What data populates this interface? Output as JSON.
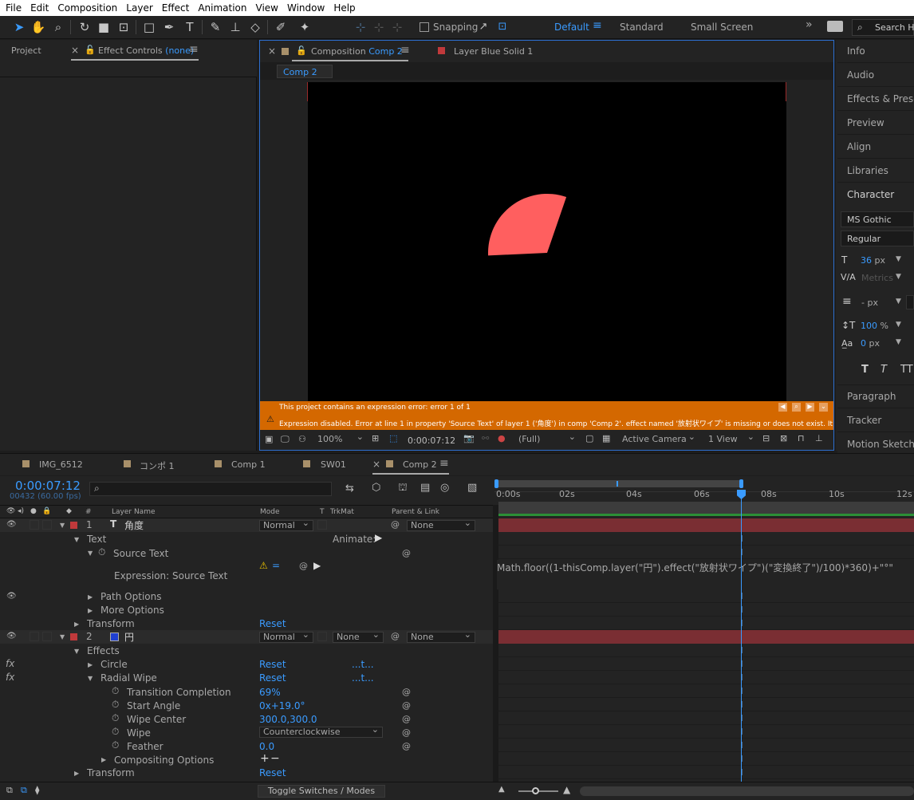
{
  "menu": [
    "File",
    "Edit",
    "Composition",
    "Layer",
    "Effect",
    "Animation",
    "View",
    "Window",
    "Help"
  ],
  "toolbar": {
    "snapping": "Snapping",
    "workspaces": [
      "Default",
      "Standard",
      "Small Screen"
    ],
    "search": "Search Help"
  },
  "left_panel": {
    "project_tab": "Project",
    "effect_controls_label": "Effect Controls",
    "effect_controls_value": "(none)"
  },
  "comp_panel": {
    "comp_tab_prefix": "Composition",
    "comp_tab_name": "Comp 2",
    "layer_tab": "Layer  Blue Solid 1",
    "subtab": "Comp 2",
    "error_title": "This project contains an expression error: error 1 of 1",
    "error_detail": "Expression disabled. Error at line 1 in property 'Source Text' of layer 1 ('角度') in comp 'Comp 2'. effect named '放射状ワイプ' is missing or does not exist. It may have been deleted or renamed.",
    "wedge_color": "#ff5f5f",
    "footer": {
      "zoom": "100%",
      "time": "0:00:07:12",
      "resolution": "(Full)",
      "camera": "Active Camera",
      "views": "1 View"
    }
  },
  "right_panel": {
    "items": [
      "Info",
      "Audio",
      "Effects & Presets",
      "Preview",
      "Align",
      "Libraries",
      "Character"
    ],
    "font": "MS Gothic",
    "style": "Regular",
    "size": "36",
    "size_unit": "px",
    "tracking": "Metrics",
    "leading": "-",
    "leading_unit": "px",
    "vscale": "100",
    "vscale_unit": "%",
    "baseline": "0",
    "baseline_unit": "px",
    "lower_items": [
      "Paragraph",
      "Tracker",
      "Motion Sketch"
    ]
  },
  "timeline_tabs": [
    {
      "name": "IMG_6512",
      "color": "#a8906a"
    },
    {
      "name": "コンポ 1",
      "color": "#a8906a"
    },
    {
      "name": "Comp 1",
      "color": "#a8906a"
    },
    {
      "name": "SW01",
      "color": "#a8906a"
    },
    {
      "name": "Comp 2",
      "color": "#a8906a"
    }
  ],
  "timeline": {
    "timecode": "0:00:07:12",
    "frames": "00432 (60.00 fps)",
    "headers": {
      "layer_name": "Layer Name",
      "mode": "Mode",
      "t": "T",
      "trkmat": "TrkMat",
      "parent": "Parent & Link",
      "hash": "#"
    },
    "ruler": [
      "0:00s",
      "02s",
      "04s",
      "06s",
      "08s",
      "10s",
      "12s"
    ],
    "rows": {
      "l1_num": "1",
      "l1_name": "角度",
      "l1_mode": "Normal",
      "l1_parent": "None",
      "text": "Text",
      "animate": "Animate:",
      "source_text": "Source Text",
      "expr_label": "Expression: Source Text",
      "expression": "Math.floor((1-thisComp.layer(\"円\").effect(\"放射状ワイプ\")(\"変換終了\")/100)*360)+\"°\"",
      "path_options": "Path Options",
      "more_options": "More Options",
      "transform": "Transform",
      "reset": "Reset",
      "l2_num": "2",
      "l2_name": "円",
      "l2_mode": "Normal",
      "l2_trkmat": "None",
      "l2_parent": "None",
      "effects": "Effects",
      "circle": "Circle",
      "radial_wipe": "Radial Wipe",
      "dots": "...t...",
      "transition": "Transition Completion",
      "transition_val": "69%",
      "start_angle": "Start Angle",
      "start_angle_val": "0x+19.0°",
      "wipe_center": "Wipe Center",
      "wipe_center_val": "300.0,300.0",
      "wipe": "Wipe",
      "wipe_val": "Counterclockwise",
      "feather": "Feather",
      "feather_val": "0.0",
      "compositing": "Compositing Options",
      "transform2": "Transform",
      "reset2": "Reset"
    }
  },
  "bottom": {
    "toggle": "Toggle Switches / Modes"
  },
  "colors": {
    "accent": "#3a9bff",
    "error_bar": "#d46800",
    "layer_bar": "#7a2e33",
    "layer1_label": "#c0393b",
    "layer2_label": "#c0393b",
    "layer2_swatch": "#1f3fd1"
  }
}
